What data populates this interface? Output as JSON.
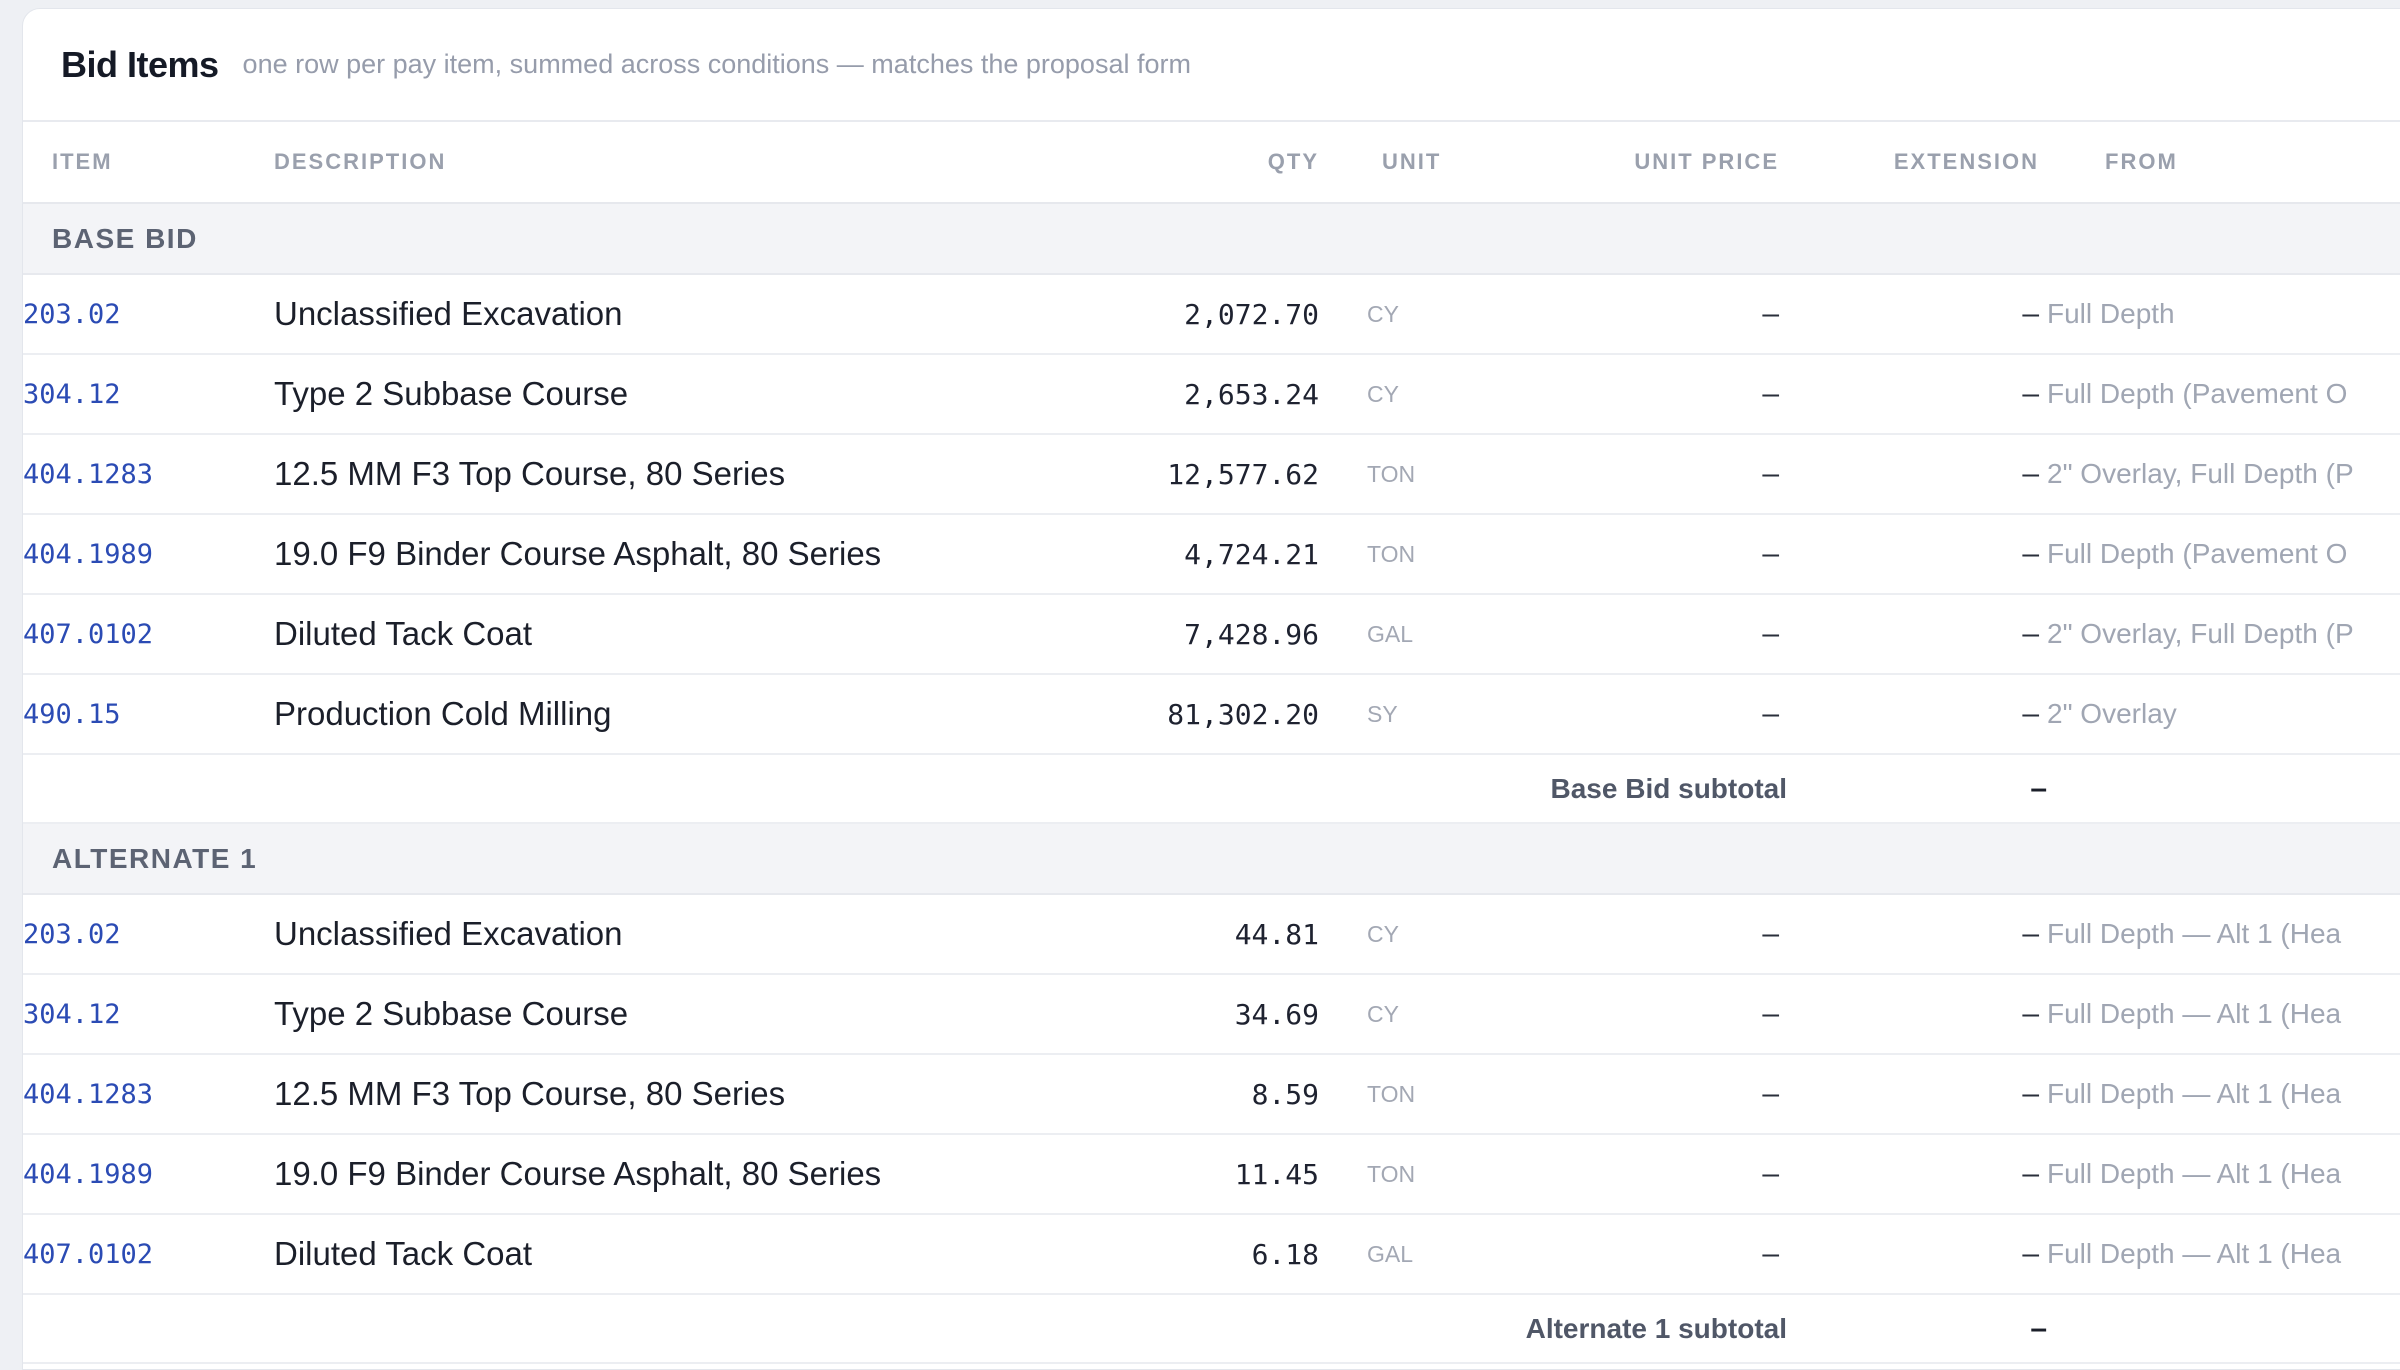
{
  "header": {
    "title": "Bid Items",
    "subtitle": "one row per pay item, summed across conditions — matches the proposal form"
  },
  "columns": {
    "item": "ITEM",
    "description": "DESCRIPTION",
    "qty": "QTY",
    "unit": "UNIT",
    "unit_price": "UNIT PRICE",
    "extension": "EXTENSION",
    "from": "FROM"
  },
  "groups": [
    {
      "name": "BASE BID",
      "rows": [
        {
          "item": "203.02",
          "description": "Unclassified Excavation",
          "qty": "2,072.70",
          "unit": "CY",
          "unit_price": "–",
          "extension": "–",
          "from": "Full Depth"
        },
        {
          "item": "304.12",
          "description": "Type 2 Subbase Course",
          "qty": "2,653.24",
          "unit": "CY",
          "unit_price": "–",
          "extension": "–",
          "from": "Full Depth (Pavement O"
        },
        {
          "item": "404.1283",
          "description": "12.5 MM F3 Top Course, 80 Series",
          "qty": "12,577.62",
          "unit": "TON",
          "unit_price": "–",
          "extension": "–",
          "from": "2\" Overlay, Full Depth (P"
        },
        {
          "item": "404.1989",
          "description": "19.0 F9 Binder Course Asphalt, 80 Series",
          "qty": "4,724.21",
          "unit": "TON",
          "unit_price": "–",
          "extension": "–",
          "from": "Full Depth (Pavement O"
        },
        {
          "item": "407.0102",
          "description": "Diluted Tack Coat",
          "qty": "7,428.96",
          "unit": "GAL",
          "unit_price": "–",
          "extension": "–",
          "from": "2\" Overlay, Full Depth (P"
        },
        {
          "item": "490.15",
          "description": "Production Cold Milling",
          "qty": "81,302.20",
          "unit": "SY",
          "unit_price": "–",
          "extension": "–",
          "from": "2\" Overlay"
        }
      ],
      "subtotal_label": "Base Bid subtotal",
      "subtotal_value": "–"
    },
    {
      "name": "ALTERNATE 1",
      "rows": [
        {
          "item": "203.02",
          "description": "Unclassified Excavation",
          "qty": "44.81",
          "unit": "CY",
          "unit_price": "–",
          "extension": "–",
          "from": "Full Depth — Alt 1 (Hea"
        },
        {
          "item": "304.12",
          "description": "Type 2 Subbase Course",
          "qty": "34.69",
          "unit": "CY",
          "unit_price": "–",
          "extension": "–",
          "from": "Full Depth — Alt 1 (Hea"
        },
        {
          "item": "404.1283",
          "description": "12.5 MM F3 Top Course, 80 Series",
          "qty": "8.59",
          "unit": "TON",
          "unit_price": "–",
          "extension": "–",
          "from": "Full Depth — Alt 1 (Hea"
        },
        {
          "item": "404.1989",
          "description": "19.0 F9 Binder Course Asphalt, 80 Series",
          "qty": "11.45",
          "unit": "TON",
          "unit_price": "–",
          "extension": "–",
          "from": "Full Depth — Alt 1 (Hea"
        },
        {
          "item": "407.0102",
          "description": "Diluted Tack Coat",
          "qty": "6.18",
          "unit": "GAL",
          "unit_price": "–",
          "extension": "–",
          "from": "Full Depth — Alt 1 (Hea"
        }
      ],
      "subtotal_label": "Alternate 1 subtotal",
      "subtotal_value": "–"
    }
  ]
}
